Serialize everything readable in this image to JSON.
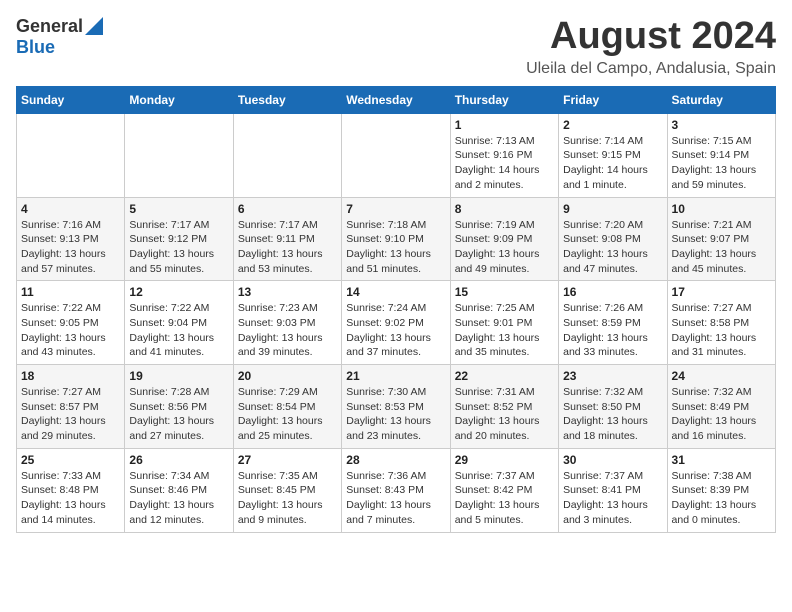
{
  "header": {
    "logo_general": "General",
    "logo_blue": "Blue",
    "title": "August 2024",
    "subtitle": "Uleila del Campo, Andalusia, Spain"
  },
  "calendar": {
    "days_of_week": [
      "Sunday",
      "Monday",
      "Tuesday",
      "Wednesday",
      "Thursday",
      "Friday",
      "Saturday"
    ],
    "weeks": [
      [
        {
          "day": "",
          "info": ""
        },
        {
          "day": "",
          "info": ""
        },
        {
          "day": "",
          "info": ""
        },
        {
          "day": "",
          "info": ""
        },
        {
          "day": "1",
          "info": "Sunrise: 7:13 AM\nSunset: 9:16 PM\nDaylight: 14 hours\nand 2 minutes."
        },
        {
          "day": "2",
          "info": "Sunrise: 7:14 AM\nSunset: 9:15 PM\nDaylight: 14 hours\nand 1 minute."
        },
        {
          "day": "3",
          "info": "Sunrise: 7:15 AM\nSunset: 9:14 PM\nDaylight: 13 hours\nand 59 minutes."
        }
      ],
      [
        {
          "day": "4",
          "info": "Sunrise: 7:16 AM\nSunset: 9:13 PM\nDaylight: 13 hours\nand 57 minutes."
        },
        {
          "day": "5",
          "info": "Sunrise: 7:17 AM\nSunset: 9:12 PM\nDaylight: 13 hours\nand 55 minutes."
        },
        {
          "day": "6",
          "info": "Sunrise: 7:17 AM\nSunset: 9:11 PM\nDaylight: 13 hours\nand 53 minutes."
        },
        {
          "day": "7",
          "info": "Sunrise: 7:18 AM\nSunset: 9:10 PM\nDaylight: 13 hours\nand 51 minutes."
        },
        {
          "day": "8",
          "info": "Sunrise: 7:19 AM\nSunset: 9:09 PM\nDaylight: 13 hours\nand 49 minutes."
        },
        {
          "day": "9",
          "info": "Sunrise: 7:20 AM\nSunset: 9:08 PM\nDaylight: 13 hours\nand 47 minutes."
        },
        {
          "day": "10",
          "info": "Sunrise: 7:21 AM\nSunset: 9:07 PM\nDaylight: 13 hours\nand 45 minutes."
        }
      ],
      [
        {
          "day": "11",
          "info": "Sunrise: 7:22 AM\nSunset: 9:05 PM\nDaylight: 13 hours\nand 43 minutes."
        },
        {
          "day": "12",
          "info": "Sunrise: 7:22 AM\nSunset: 9:04 PM\nDaylight: 13 hours\nand 41 minutes."
        },
        {
          "day": "13",
          "info": "Sunrise: 7:23 AM\nSunset: 9:03 PM\nDaylight: 13 hours\nand 39 minutes."
        },
        {
          "day": "14",
          "info": "Sunrise: 7:24 AM\nSunset: 9:02 PM\nDaylight: 13 hours\nand 37 minutes."
        },
        {
          "day": "15",
          "info": "Sunrise: 7:25 AM\nSunset: 9:01 PM\nDaylight: 13 hours\nand 35 minutes."
        },
        {
          "day": "16",
          "info": "Sunrise: 7:26 AM\nSunset: 8:59 PM\nDaylight: 13 hours\nand 33 minutes."
        },
        {
          "day": "17",
          "info": "Sunrise: 7:27 AM\nSunset: 8:58 PM\nDaylight: 13 hours\nand 31 minutes."
        }
      ],
      [
        {
          "day": "18",
          "info": "Sunrise: 7:27 AM\nSunset: 8:57 PM\nDaylight: 13 hours\nand 29 minutes."
        },
        {
          "day": "19",
          "info": "Sunrise: 7:28 AM\nSunset: 8:56 PM\nDaylight: 13 hours\nand 27 minutes."
        },
        {
          "day": "20",
          "info": "Sunrise: 7:29 AM\nSunset: 8:54 PM\nDaylight: 13 hours\nand 25 minutes."
        },
        {
          "day": "21",
          "info": "Sunrise: 7:30 AM\nSunset: 8:53 PM\nDaylight: 13 hours\nand 23 minutes."
        },
        {
          "day": "22",
          "info": "Sunrise: 7:31 AM\nSunset: 8:52 PM\nDaylight: 13 hours\nand 20 minutes."
        },
        {
          "day": "23",
          "info": "Sunrise: 7:32 AM\nSunset: 8:50 PM\nDaylight: 13 hours\nand 18 minutes."
        },
        {
          "day": "24",
          "info": "Sunrise: 7:32 AM\nSunset: 8:49 PM\nDaylight: 13 hours\nand 16 minutes."
        }
      ],
      [
        {
          "day": "25",
          "info": "Sunrise: 7:33 AM\nSunset: 8:48 PM\nDaylight: 13 hours\nand 14 minutes."
        },
        {
          "day": "26",
          "info": "Sunrise: 7:34 AM\nSunset: 8:46 PM\nDaylight: 13 hours\nand 12 minutes."
        },
        {
          "day": "27",
          "info": "Sunrise: 7:35 AM\nSunset: 8:45 PM\nDaylight: 13 hours\nand 9 minutes."
        },
        {
          "day": "28",
          "info": "Sunrise: 7:36 AM\nSunset: 8:43 PM\nDaylight: 13 hours\nand 7 minutes."
        },
        {
          "day": "29",
          "info": "Sunrise: 7:37 AM\nSunset: 8:42 PM\nDaylight: 13 hours\nand 5 minutes."
        },
        {
          "day": "30",
          "info": "Sunrise: 7:37 AM\nSunset: 8:41 PM\nDaylight: 13 hours\nand 3 minutes."
        },
        {
          "day": "31",
          "info": "Sunrise: 7:38 AM\nSunset: 8:39 PM\nDaylight: 13 hours\nand 0 minutes."
        }
      ]
    ]
  }
}
